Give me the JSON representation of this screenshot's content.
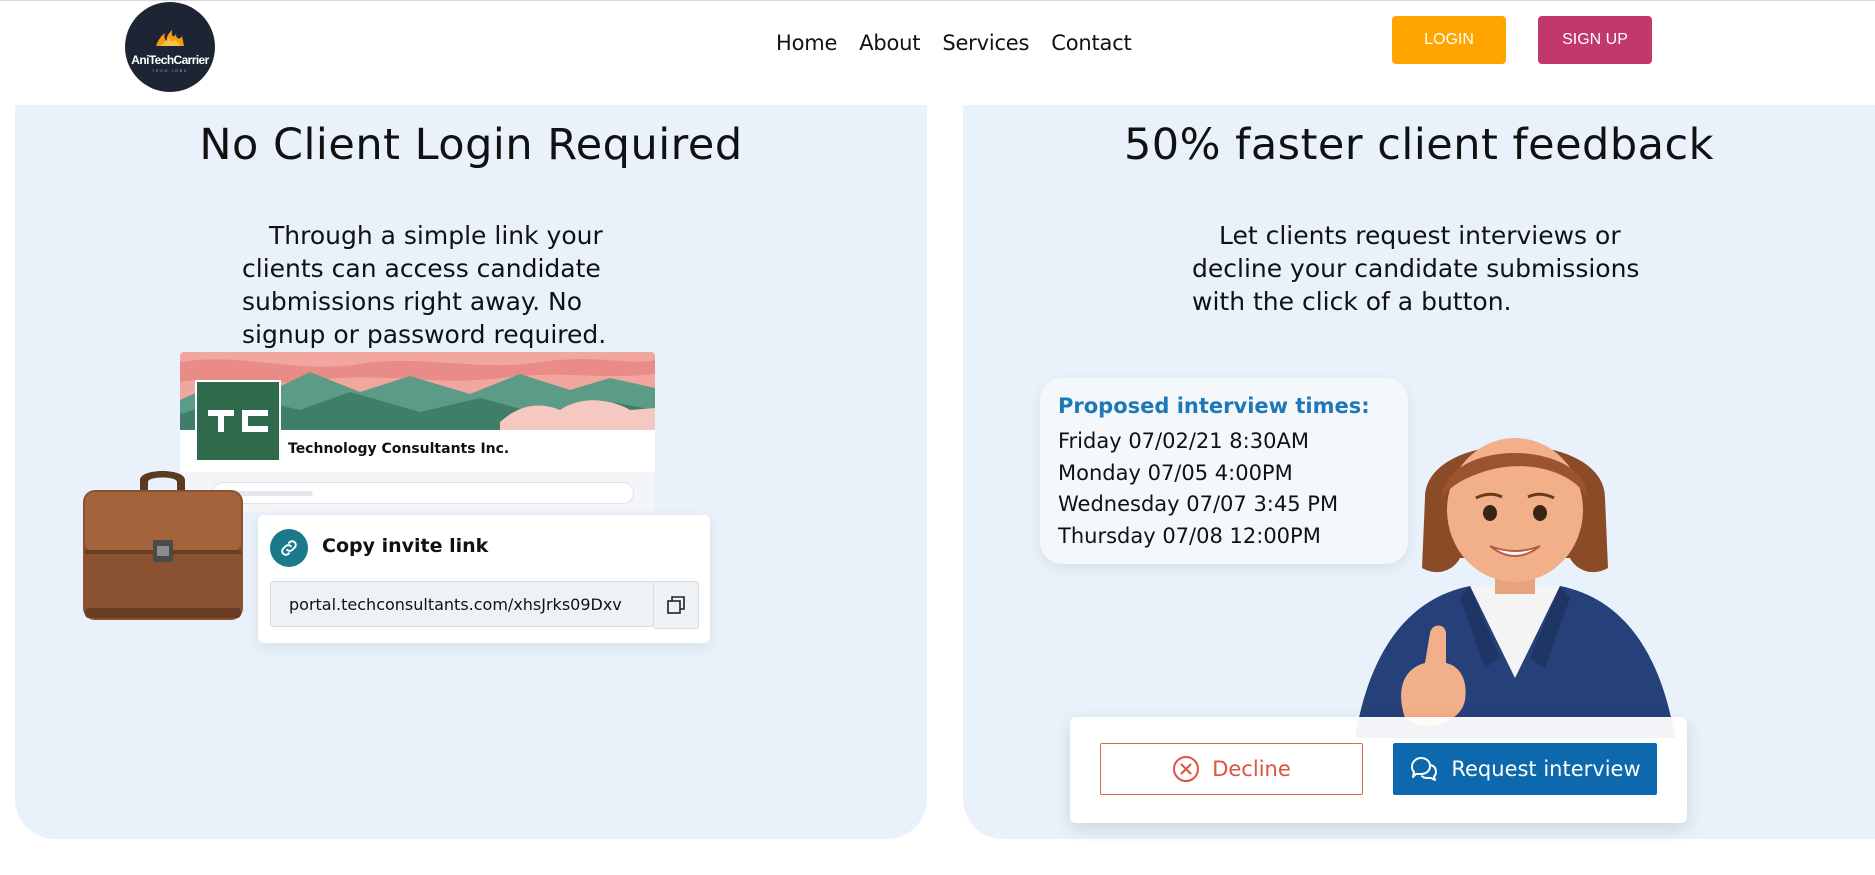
{
  "brand": {
    "name": "AniTechCarrier",
    "tagline": "TECH JOBS"
  },
  "nav": {
    "items": [
      {
        "label": "Home"
      },
      {
        "label": "About"
      },
      {
        "label": "Services"
      },
      {
        "label": "Contact"
      }
    ]
  },
  "auth": {
    "login_label": "LOGIN",
    "signup_label": "SIGN UP"
  },
  "feature_left": {
    "title": "No Client Login Required",
    "body": "Through a simple link your clients can access candidate submissions right away. No signup or password required.",
    "portal": {
      "company": "Technology Consultants Inc.",
      "logo_text": "TC"
    },
    "invite": {
      "title": "Copy invite link",
      "url": "portal.techconsultants.com/xhsJrks09Dxv"
    }
  },
  "feature_right": {
    "title": "50% faster client feedback",
    "body": "Let clients request interviews or decline your candidate submissions with the click of a button.",
    "times": {
      "title": "Proposed interview times:",
      "rows": [
        "Friday   07/02/21 8:30AM",
        "Monday  07/05 4:00PM",
        "Wednesday 07/07 3:45 PM",
        "Thursday 07/08 12:00PM"
      ]
    },
    "actions": {
      "decline_label": "Decline",
      "request_label": "Request interview"
    }
  },
  "colors": {
    "card_bg": "#e9f1fa",
    "login": "#ffa500",
    "signup": "#c2386a",
    "primary_blue": "#0d68ad",
    "decline_red": "#e0523f"
  }
}
